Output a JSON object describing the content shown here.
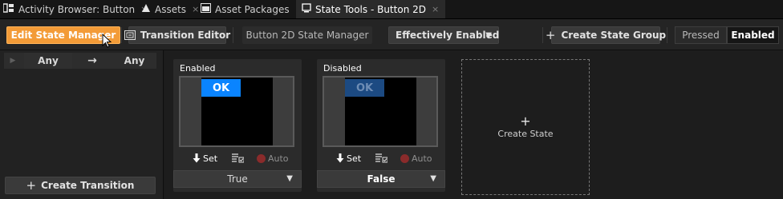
{
  "tabs": [
    {
      "label": "Activity Browser: Button",
      "icon": "activity-browser-icon",
      "close": "×",
      "active": false
    },
    {
      "label": "Assets",
      "icon": "assets-icon",
      "close": "×",
      "active": false
    },
    {
      "label": "Asset Packages",
      "icon": "asset-packages-icon",
      "close": "×",
      "active": false
    },
    {
      "label": "State Tools - Button 2D",
      "icon": "state-tools-icon",
      "close": "×",
      "active": true
    }
  ],
  "toolbar": {
    "edit_state_manager": "Edit State Manager",
    "transition_editor": "Transition Editor",
    "state_manager_name": "Button 2D State Manager",
    "property_dropdown": "Effectively Enabled",
    "create_state_group": "Create State Group",
    "pressed": "Pressed",
    "enabled": "Enabled"
  },
  "transitions": {
    "from": "Any",
    "arrow": "→",
    "to": "Any",
    "create_transition": "Create Transition"
  },
  "states": [
    {
      "title": "Enabled",
      "button_text": "OK",
      "set_label": "Set",
      "auto_label": "Auto",
      "value": "True"
    },
    {
      "title": "Disabled",
      "button_text": "OK",
      "set_label": "Set",
      "auto_label": "Auto",
      "value": "False"
    }
  ],
  "create_state": {
    "plus": "+",
    "label": "Create State"
  },
  "colors": {
    "accent_orange": "#f39b37",
    "ok_enabled_bg": "#0a84ff",
    "ok_enabled_text": "#ffffff",
    "ok_disabled_bg": "#1c4a82",
    "ok_disabled_text": "#6e8db5"
  }
}
